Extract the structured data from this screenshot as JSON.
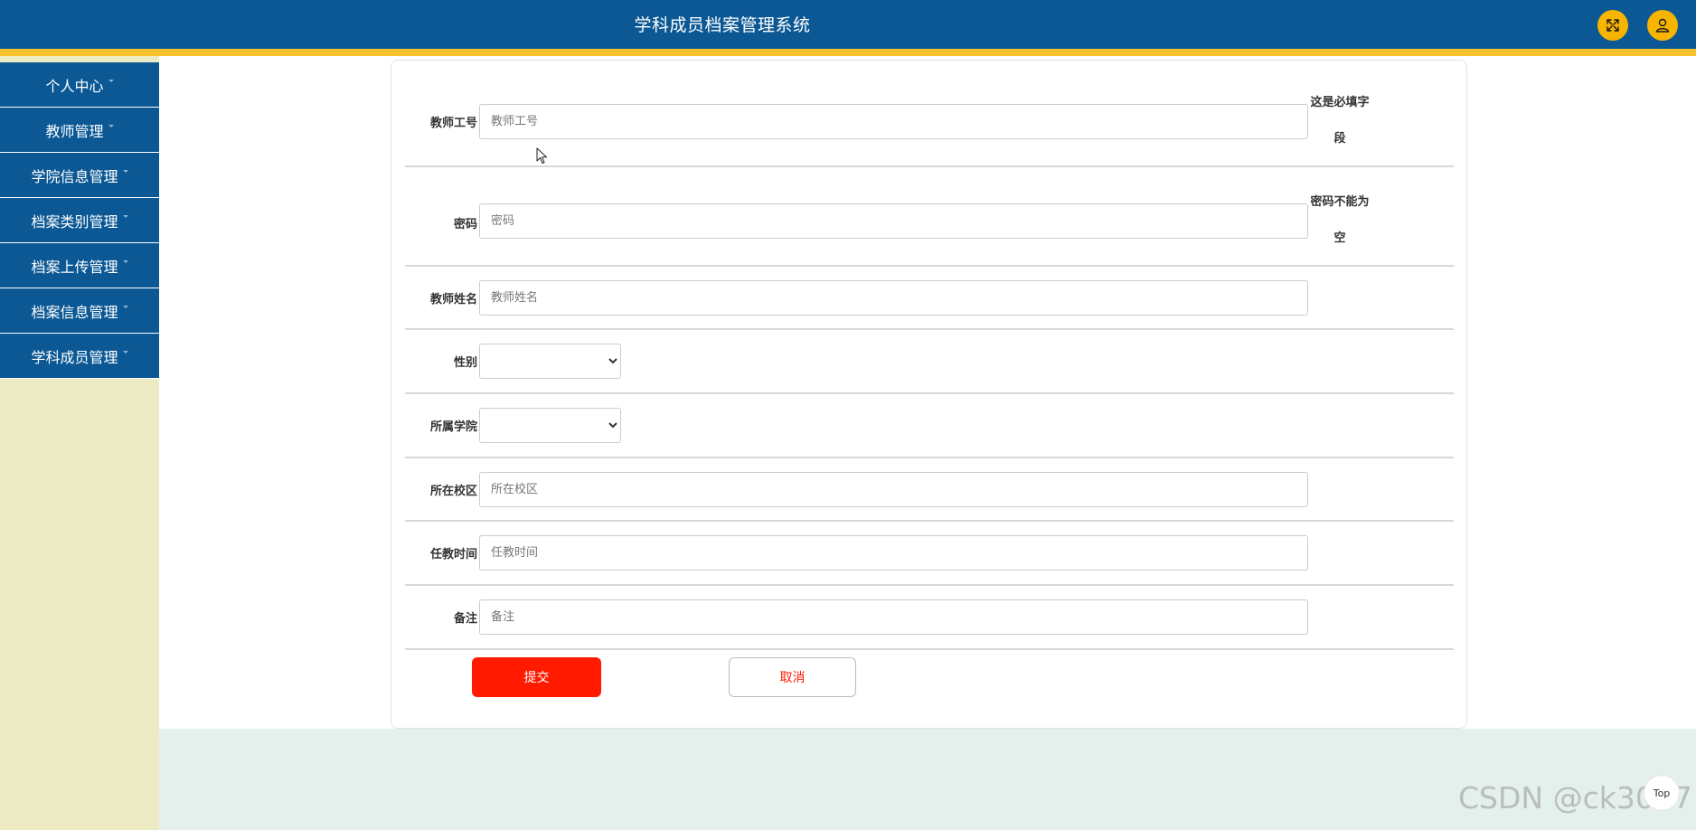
{
  "header": {
    "title": "学科成员档案管理系统",
    "accent_color": "#0b5895",
    "strip_color": "#f7c22e",
    "fullscreen_icon": "fullscreen-icon",
    "user_icon": "user-icon"
  },
  "sidebar": {
    "items": [
      {
        "label": "个人中心"
      },
      {
        "label": "教师管理"
      },
      {
        "label": "学院信息管理"
      },
      {
        "label": "档案类别管理"
      },
      {
        "label": "档案上传管理"
      },
      {
        "label": "档案信息管理"
      },
      {
        "label": "学科成员管理"
      }
    ]
  },
  "form": {
    "fields": [
      {
        "label": "教师工号",
        "placeholder": "教师工号",
        "hint": "这是必填字段"
      },
      {
        "label": "密码",
        "placeholder": "密码",
        "hint": "密码不能为空"
      },
      {
        "label": "教师姓名",
        "placeholder": "教师姓名"
      },
      {
        "label": "性别",
        "value": ""
      },
      {
        "label": "所属学院",
        "value": ""
      },
      {
        "label": "所在校区",
        "placeholder": "所在校区"
      },
      {
        "label": "任教时间",
        "placeholder": "任教时间"
      },
      {
        "label": "备注",
        "placeholder": "备注"
      }
    ],
    "submit_label": "提交",
    "cancel_label": "取消",
    "submit_color": "#ff1a00"
  },
  "footer": {
    "watermark": "CSDN @ck3017",
    "top_label": "Top"
  }
}
